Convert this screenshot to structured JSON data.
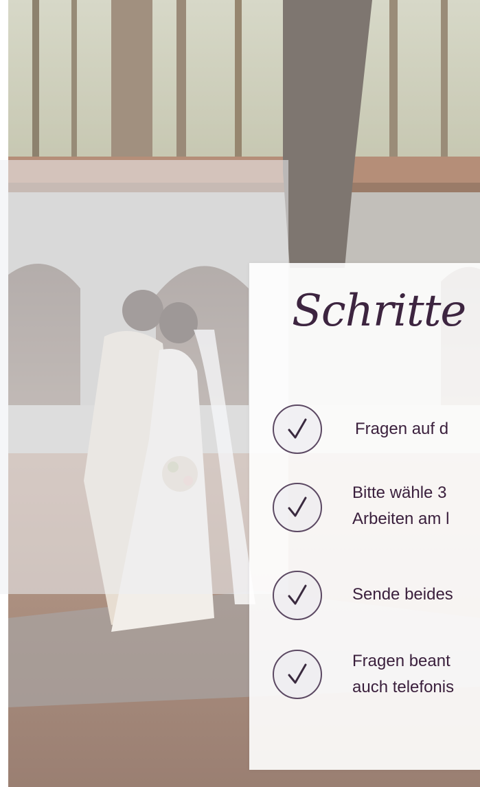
{
  "hero_image": {
    "subject": "wedding-couple-kissing-in-front-of-stone-arcade"
  },
  "card": {
    "title": "Schritte",
    "steps": [
      {
        "icon": "check-circle-icon",
        "lines": [
          "Fragen auf d"
        ]
      },
      {
        "icon": "check-circle-icon",
        "lines": [
          "Bitte wähle 3",
          "Arbeiten am l"
        ]
      },
      {
        "icon": "check-circle-icon",
        "lines": [
          "Sende beides"
        ]
      },
      {
        "icon": "check-circle-icon",
        "lines": [
          "Fragen beant",
          "auch telefonis"
        ]
      }
    ]
  },
  "colors": {
    "title": "#3d2540",
    "text": "#3a1f3c",
    "check_stroke": "#5b4862",
    "card_background": "#ffffff"
  }
}
